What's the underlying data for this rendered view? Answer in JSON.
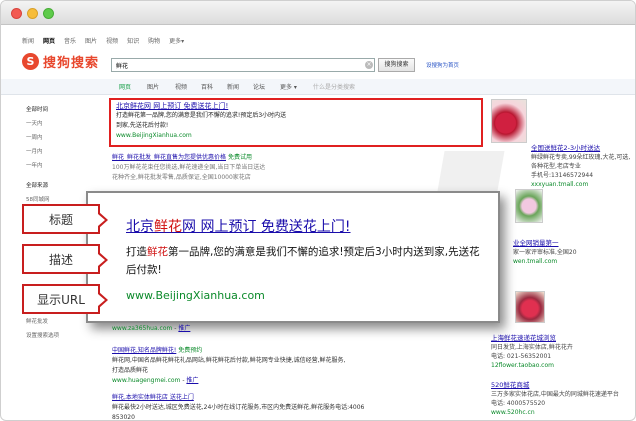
{
  "topnav": {
    "items": [
      "新闻",
      "网页",
      "音乐",
      "图片",
      "视频",
      "知识",
      "购物",
      "更多▾"
    ],
    "active_index": 1
  },
  "logo": {
    "mark": "S",
    "text": "搜狗搜索"
  },
  "search": {
    "query": "鲜花",
    "button": "搜狗搜索",
    "extra_link": "设搜狗为首页"
  },
  "tabs": {
    "items": [
      "网页",
      "图片",
      "视频",
      "百科",
      "新闻",
      "论坛",
      "更多 ▾"
    ],
    "hint": "什么是分类搜索"
  },
  "sidebar": {
    "time_head": "全部时间",
    "time_items": [
      "一天内",
      "一周内",
      "一月内",
      "一年内"
    ],
    "source_head": "全部来源",
    "source_items": [
      "58同城网",
      "鲜花批发",
      "设置搜索选项"
    ]
  },
  "result1": {
    "title": "北京鲜花网  网上预订  免费送花上门!",
    "desc_line1": "打造鲜花第一品牌,您的满意是我们不懈的追求!预定后3小时内送",
    "desc_line2": "到家,先送花后付款!",
    "url": "www.BeijingXianhua.com"
  },
  "result2": {
    "title": "鲜花_鲜花批发_鲜花直售为您提供优惠价格",
    "extra": "免费试用",
    "desc": "100万鲜花花束任您挑选,鲜花速递全国,当日下单当日送达",
    "desc2": "花种齐全,鲜花批发零售,品质保证,全国10000家花店"
  },
  "callout": {
    "title_pre": "北京",
    "title_hl": "鲜花",
    "title_post": "网  网上预订  免费送花上门!",
    "desc_pre": "打造",
    "desc_hl": "鲜花",
    "desc_post": "第一品牌,您的满意是我们不懈的追求!预定后3小时内送到家,先送花后付款!",
    "url": "www.BeijingXianhua.com"
  },
  "labels": {
    "title": "标题",
    "desc": "描述",
    "url": "显示URL"
  },
  "result3": {
    "url": "www.za365hua.com",
    "tag": "推广"
  },
  "result4": {
    "title": "中国鲜花,知名品牌鲜花!",
    "extra": "免费预约",
    "desc1": "鲜花网,中国名品鲜花鲜花礼品网站,鲜花鲜花后付款,鲜花网专业快捷,诚信经营,鲜花服务,",
    "desc2": "打造品质鲜花",
    "url": "www.huagengmei.com",
    "tag": "推广"
  },
  "result5": {
    "title": "鲜花,本地实体鲜花店 送花上门",
    "desc1": "鲜花最快2小时送达,城区免费送花,24小时在线订花服务,市区内免费送鲜花,鲜花服务电话:4006",
    "desc2": "853020"
  },
  "right_ads": {
    "ad1_title": "全国送鲜花2-3小时送达",
    "ad1_desc": "鲜绿鲜花专卖,99朵红玫瑰,大花,可选,各种花型,老店专业",
    "ad1_phone": "手机号:13146572944",
    "ad1_url": "xxxyuan.tmall.com",
    "ad2_title": "业全网销量第一",
    "ad2_desc": "家一家评审标准,全国20",
    "ad2_url": "wen.tmall.com",
    "ad3_title": "上海鲜花速递花城浏览",
    "ad3_desc": "同日发货,上海实体店,鲜花花卉",
    "ad3_phone": "电话: 021-56352001",
    "ad3_url": "12flower.taobao.com",
    "ad4_title": "520鲜花商城",
    "ad4_desc": "三万多家实体花店,中国最大的同城鲜花速递平台",
    "ad4_phone": "电话: 4000575520",
    "ad4_url": "www.520hc.cn"
  }
}
